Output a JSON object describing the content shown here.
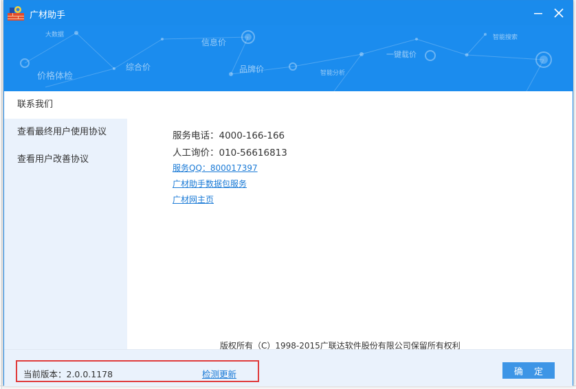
{
  "window": {
    "title": "广材助手",
    "minimize_symbol": "—",
    "close_symbol": "✕"
  },
  "banner": {
    "labels": [
      "大数据",
      "信息价",
      "智能搜索",
      "一键载价",
      "综合价",
      "品牌价",
      "智能分析",
      "价格体检"
    ]
  },
  "sidebar": {
    "items": [
      {
        "label": "联系我们",
        "active": true
      },
      {
        "label": "查看最终用户使用协议",
        "active": false
      },
      {
        "label": "查看用户改善协议",
        "active": false
      }
    ]
  },
  "contact": {
    "service_phone": "服务电话：4000-166-166",
    "price_inquiry": "人工询价：010-56616813",
    "service_qq": "服务QQ：800017397",
    "data_package": "广材助手数据包服务",
    "homepage": "广材网主页"
  },
  "copyright": "版权所有（C）1998-2015广联达软件股份有限公司保留所有权利",
  "footer": {
    "version": "当前版本：2.0.0.1178",
    "check_update": "检测更新",
    "ok_button": "确 定"
  },
  "colors": {
    "titlebar": "#1a8bec",
    "banner": "#1b8cee",
    "sidebar_bg": "#eaf2fc",
    "link": "#1a7ad6",
    "highlight_box": "#e03b3b",
    "ok_button": "#3d95e6"
  }
}
